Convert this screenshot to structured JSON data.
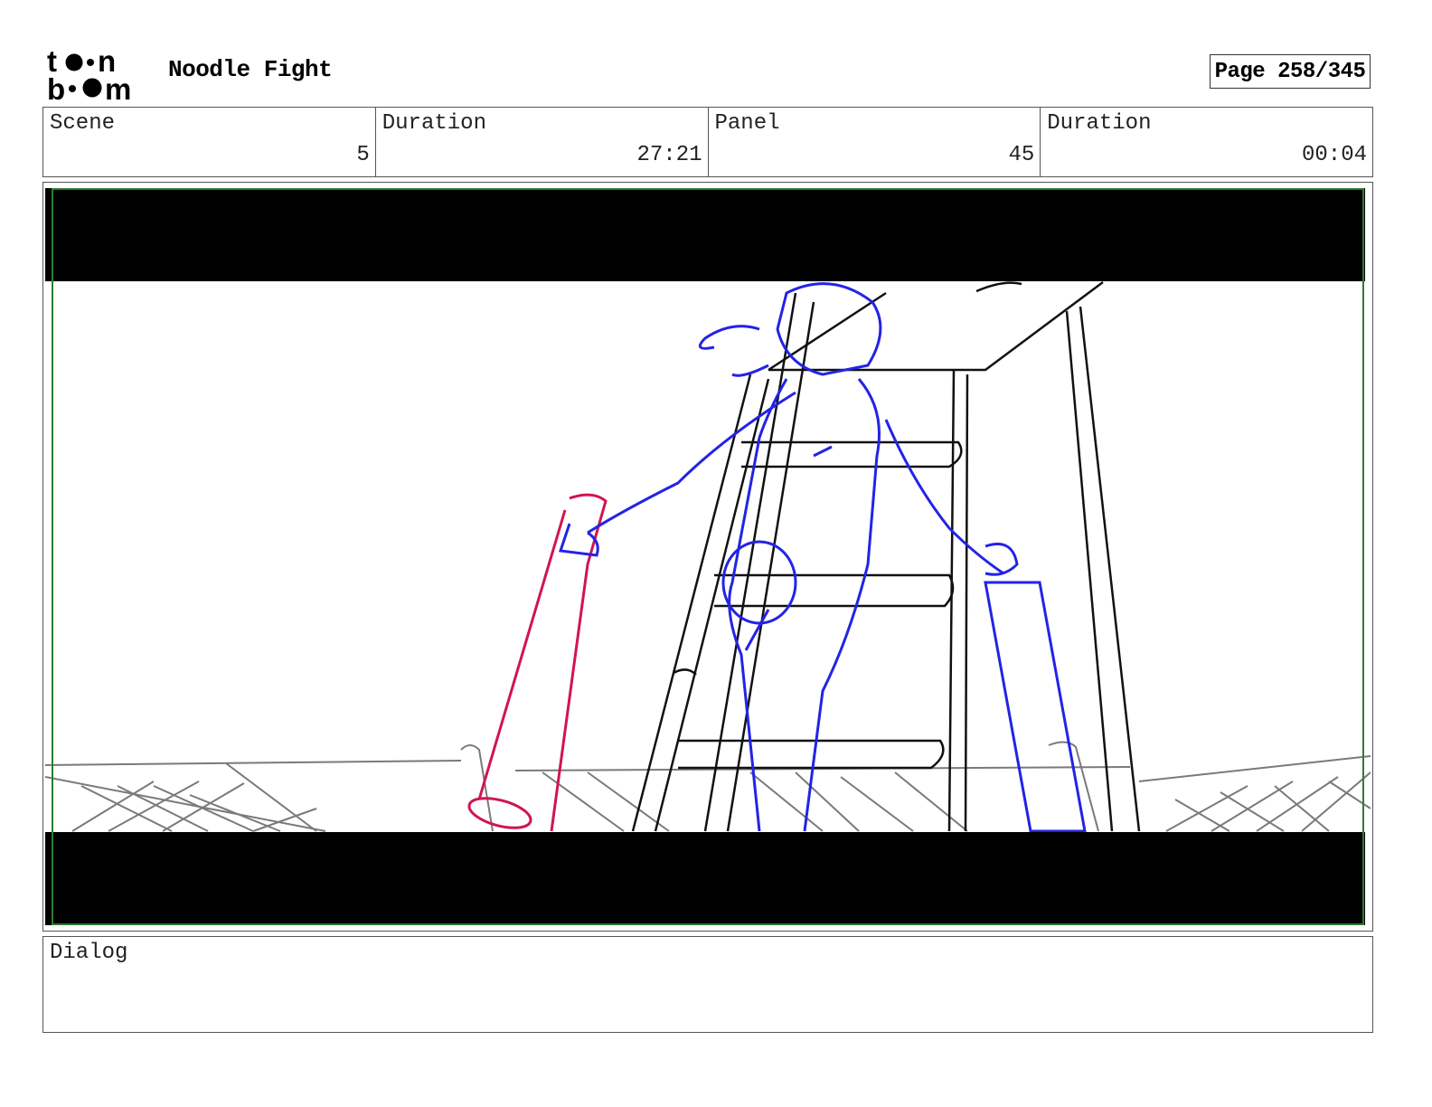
{
  "header": {
    "project_title": "Noodle Fight",
    "page_label": "Page 258/345",
    "logo_text": "toon boom"
  },
  "info": {
    "scene_label": "Scene",
    "scene_value": "5",
    "scene_duration_label": "Duration",
    "scene_duration_value": "27:21",
    "panel_label": "Panel",
    "panel_value": "45",
    "panel_duration_label": "Duration",
    "panel_duration_value": "00:04"
  },
  "panel": {
    "image_icon": "storyboard-sketch",
    "colors": {
      "character": "#2323e6",
      "bat": "#d01550",
      "ladder": "#111111",
      "fence": "#7a7a7a",
      "frame_border": "#2e7d32"
    }
  },
  "dialog": {
    "label": "Dialog",
    "text": ""
  }
}
